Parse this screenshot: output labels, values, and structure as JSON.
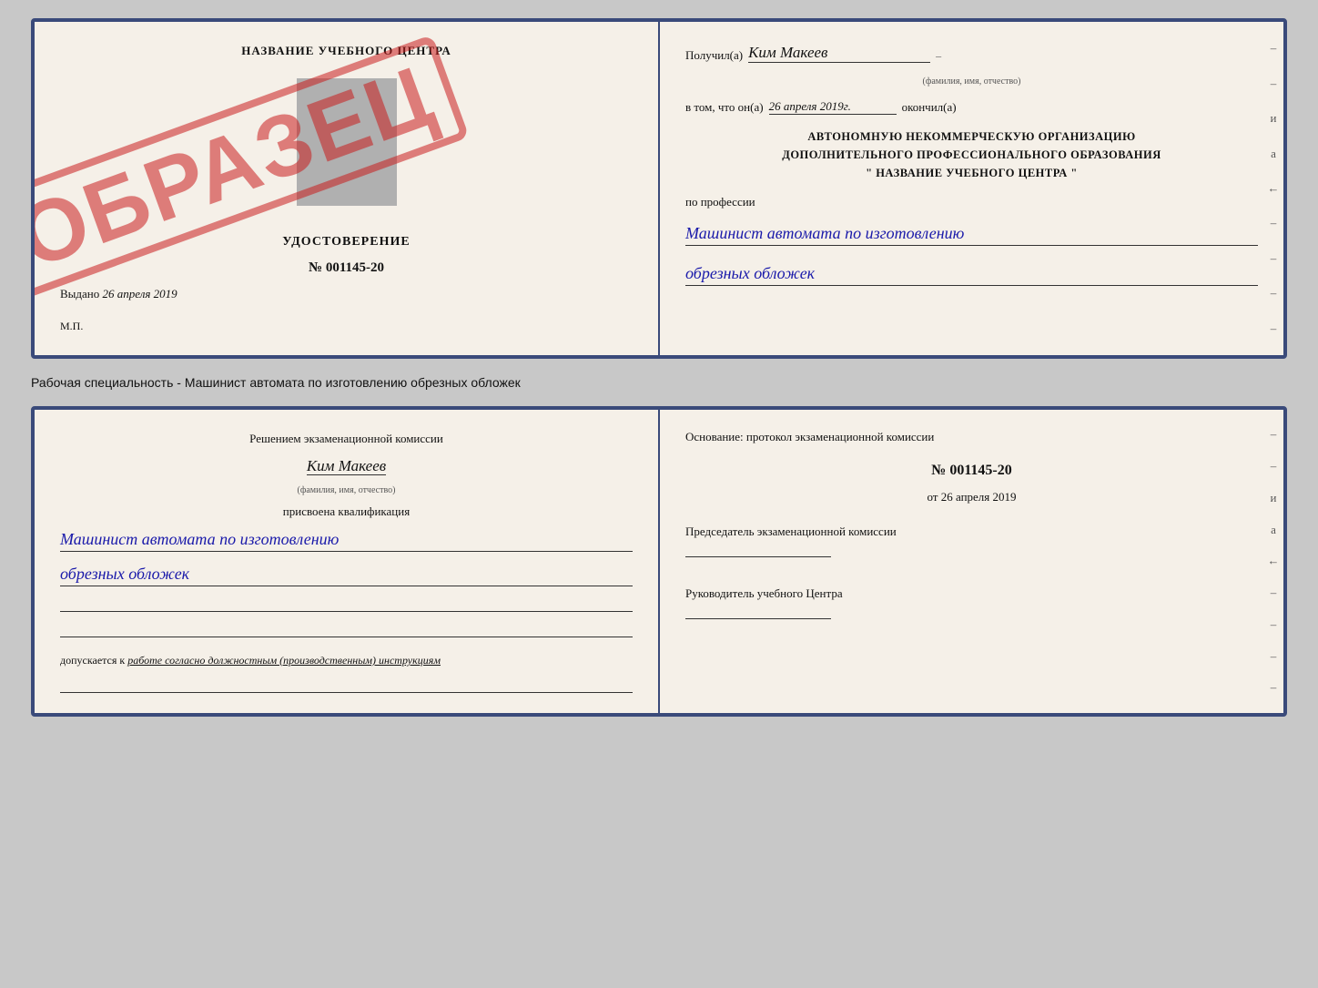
{
  "card1": {
    "left": {
      "center_name": "НАЗВАНИЕ УЧЕБНОГО ЦЕНТРА",
      "stamp": "ОБРАЗЕЦ",
      "cert_title": "УДОСТОВЕРЕНИЕ",
      "cert_number": "№ 001145-20",
      "issued_label": "Выдано",
      "issued_date": "26 апреля 2019",
      "mp_label": "М.П."
    },
    "right": {
      "recipient_prefix": "Получил(а)",
      "recipient_name": "Ким Макеев",
      "recipient_sublabel": "(фамилия, имя, отчество)",
      "date_prefix": "в том, что он(а)",
      "date_value": "26 апреля 2019г.",
      "date_suffix": "окончил(а)",
      "org_line1": "АВТОНОМНУЮ НЕКОММЕРЧЕСКУЮ ОРГАНИЗАЦИЮ",
      "org_line2": "ДОПОЛНИТЕЛЬНОГО ПРОФЕССИОНАЛЬНОГО ОБРАЗОВАНИЯ",
      "org_line3": "\"   НАЗВАНИЕ УЧЕБНОГО ЦЕНТРА   \"",
      "profession_label": "по профессии",
      "profession_value1": "Машинист автомата по изготовлению",
      "profession_value2": "обрезных обложек"
    }
  },
  "separator": "Рабочая специальность - Машинист автомата по изготовлению обрезных обложек",
  "card2": {
    "left": {
      "commission_line1": "Решением экзаменационной комиссии",
      "person_name": "Ким Макеев",
      "person_sublabel": "(фамилия, имя, отчество)",
      "qualification_label": "присвоена квалификация",
      "qualification_value1": "Машинист автомата по изготовлению",
      "qualification_value2": "обрезных обложек",
      "permission_prefix": "допускается к",
      "permission_value": "работе согласно должностным (производственным) инструкциям"
    },
    "right": {
      "basis_label": "Основание: протокол экзаменационной комиссии",
      "protocol_number": "№ 001145-20",
      "protocol_date_prefix": "от",
      "protocol_date": "26 апреля 2019",
      "chairman_label": "Председатель экзаменационной комиссии",
      "director_label": "Руководитель учебного Центра"
    }
  }
}
